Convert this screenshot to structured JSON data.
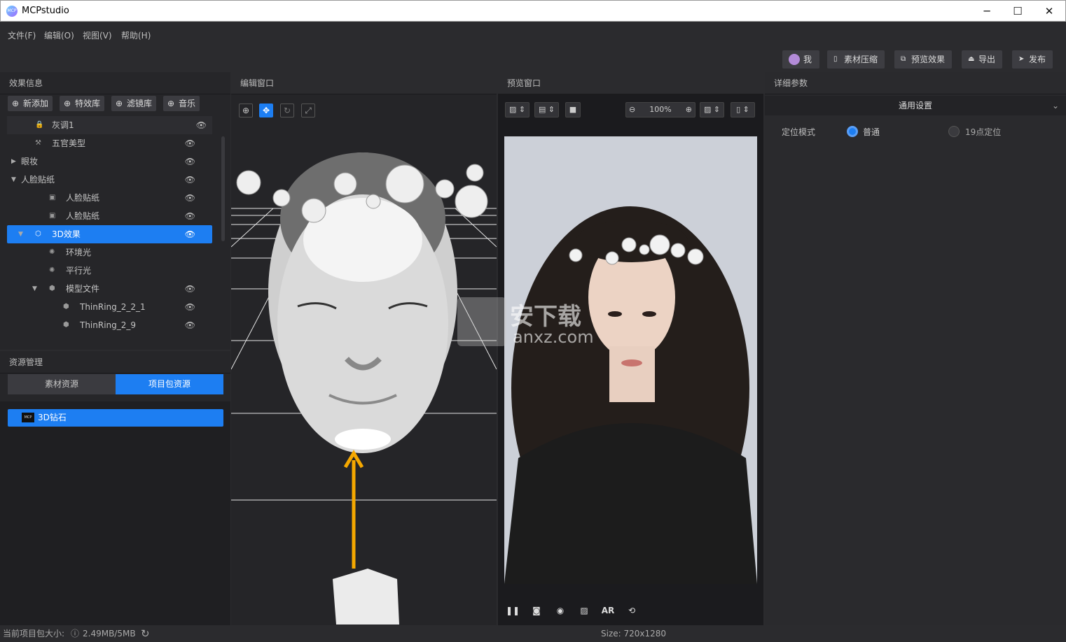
{
  "app": {
    "title": "MCPstudio",
    "logo_text": "MCP"
  },
  "window_controls": {
    "minimize": "─",
    "maximize": "☐",
    "close": "✕"
  },
  "menu": [
    "文件(F)",
    "编辑(O)",
    "视图(V)",
    "帮助(H)"
  ],
  "toolbar": {
    "me": "我",
    "compress": "素材压缩",
    "preview": "预览效果",
    "export": "导出",
    "publish": "发布"
  },
  "effects_panel": {
    "title": "效果信息",
    "buttons": [
      "新添加",
      "特效库",
      "滤镜库",
      "音乐"
    ],
    "tree": [
      {
        "label": "灰调1",
        "level": 1,
        "icon": "lock-icon",
        "eye": true
      },
      {
        "label": "五官美型",
        "level": 1,
        "icon": "adjust-icon",
        "eye": true
      },
      {
        "label": "眼妆",
        "level": 0,
        "icon": "",
        "eye": true,
        "arrow": "collapsed"
      },
      {
        "label": "人脸贴纸",
        "level": 0,
        "icon": "",
        "eye": true,
        "arrow": "expanded"
      },
      {
        "label": "人脸贴纸",
        "level": 2,
        "icon": "sticker-icon",
        "eye": true
      },
      {
        "label": "人脸贴纸",
        "level": 2,
        "icon": "sticker-icon",
        "eye": true
      },
      {
        "label": "3D效果",
        "level": 1,
        "icon": "cube-icon",
        "eye": true,
        "arrow": "expanded",
        "selected": true
      },
      {
        "label": "环境光",
        "level": 2,
        "icon": "light-icon",
        "eye": false
      },
      {
        "label": "平行光",
        "level": 2,
        "icon": "light-icon",
        "eye": false
      },
      {
        "label": "模型文件",
        "level": 2,
        "icon": "model-icon",
        "eye": true,
        "arrow": "expanded"
      },
      {
        "label": "ThinRing_2_2_1",
        "level": 3,
        "icon": "model-icon",
        "eye": true
      },
      {
        "label": "ThinRing_2_9",
        "level": 3,
        "icon": "model-icon",
        "eye": true
      }
    ]
  },
  "resource_panel": {
    "title": "资源管理",
    "tabs": [
      "素材资源",
      "项目包资源"
    ],
    "active_tab": 1,
    "items": [
      {
        "label": "3D钻石",
        "badge": "MCP"
      }
    ]
  },
  "editor": {
    "title": "编辑窗口"
  },
  "preview": {
    "title": "预览窗口",
    "zoom": "100%",
    "size": "Size: 720x1280",
    "ar_label": "AR"
  },
  "details": {
    "title": "详细参数",
    "section": "通用设置",
    "field_label": "定位模式",
    "options": [
      "普通",
      "19点定位"
    ],
    "selected_option": 0
  },
  "watermark": {
    "line1": "安下载",
    "line2": "anxz.com"
  },
  "status": {
    "label": "当前项目包大小:",
    "value": "2.49MB/5MB"
  },
  "colors": {
    "accent": "#1d7ef2",
    "arrow": "#f5a800"
  }
}
